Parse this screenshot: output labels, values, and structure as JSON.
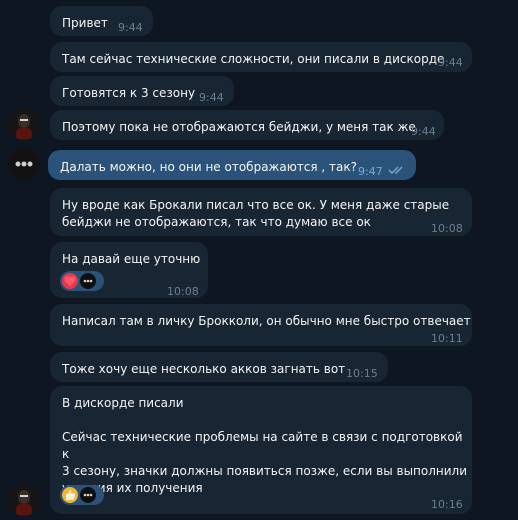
{
  "messages": [
    {
      "text": "Привет",
      "time": "9:44"
    },
    {
      "text": "Там сейчас технические сложности, они писали в дискорде",
      "time": "9:44"
    },
    {
      "text": "Готовятся к 3 сезону",
      "time": "9:44"
    },
    {
      "text": "Поэтому пока не отображаются бейджи, у меня так же",
      "time": "9:44"
    },
    {
      "text": "Далать можно, но они не отображаются , так?",
      "time": "9:47",
      "read_status": "read"
    },
    {
      "text": "Ну вроде как Брокали писал что все ок. У меня даже старые\nбейджи не отображаются, так что думаю все ок",
      "time": "10:08"
    },
    {
      "text": "На давай еще уточню",
      "time": "10:08",
      "reaction": "heart-eyes"
    },
    {
      "text": "Написал там в личку Брокколи, он обычно мне быстро отвечает",
      "time": "10:11"
    },
    {
      "text": "Тоже хочу еще несколько акков загнать вот",
      "time": "10:15"
    },
    {
      "text": "В дискорде писали\n\nСейчас технические проблемы на сайте в связи с подготовкой к\n3 сезону, значки должны появиться позже, если вы выполнили\nусловия их получения",
      "time": "10:16",
      "reaction": "thumbs-up"
    }
  ],
  "colors": {
    "background": "#0e1621",
    "incoming_bubble": "#182533",
    "outgoing_bubble": "#2b5278",
    "time_in": "#6d7f8f",
    "time_out": "#7da8d3"
  }
}
